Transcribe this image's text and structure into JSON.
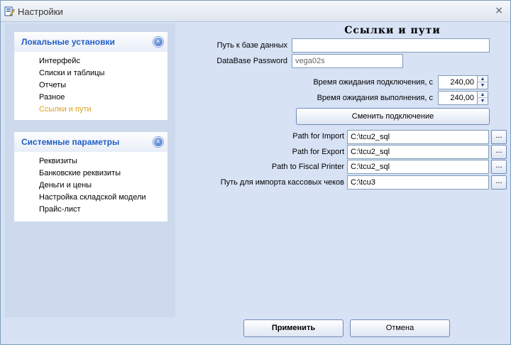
{
  "window": {
    "title": "Настройки",
    "close_glyph": "×",
    "icon": "settings-app-icon"
  },
  "sidebar": {
    "groups": [
      {
        "title": "Локальные установки",
        "collapse_glyph": "˄",
        "items": [
          {
            "label": "Интерфейс"
          },
          {
            "label": "Списки и таблицы"
          },
          {
            "label": "Отчеты"
          },
          {
            "label": "Разное"
          },
          {
            "label": "Ссылки и пути",
            "active": true
          }
        ]
      },
      {
        "title": "Системные параметры",
        "collapse_glyph": "˄",
        "items": [
          {
            "label": "Реквизиты"
          },
          {
            "label": "Банковские реквизиты"
          },
          {
            "label": "Деньги и цены"
          },
          {
            "label": "Настройка складской модели"
          },
          {
            "label": "Прайс-лист"
          }
        ]
      }
    ],
    "active_color": "#e0a020"
  },
  "main": {
    "heading": "Ссылки и пути",
    "db_path": {
      "label": "Путь к базе данных",
      "value": ""
    },
    "db_password": {
      "label": "DataBase Password",
      "value": "vega02s"
    },
    "connect_timeout": {
      "label": "Время ожидания подключения, с",
      "value": "240,00"
    },
    "exec_timeout": {
      "label": "Время ожидания выполнения, с",
      "value": "240,00"
    },
    "change_connection": "Сменить подключение",
    "paths": [
      {
        "label": "Path for Import",
        "value": "C:\\tcu2_sql",
        "browse": "..."
      },
      {
        "label": "Path for Export",
        "value": "C:\\tcu2_sql",
        "browse": "..."
      },
      {
        "label": "Path to Fiscal Printer",
        "value": "C:\\tcu2_sql",
        "browse": "..."
      },
      {
        "label": "Путь для импорта кассовых чеков",
        "value": "C:\\tcu3",
        "browse": "..."
      }
    ]
  },
  "footer": {
    "apply": "Применить",
    "cancel": "Отмена"
  },
  "spin": {
    "up": "▲",
    "down": "▼"
  }
}
